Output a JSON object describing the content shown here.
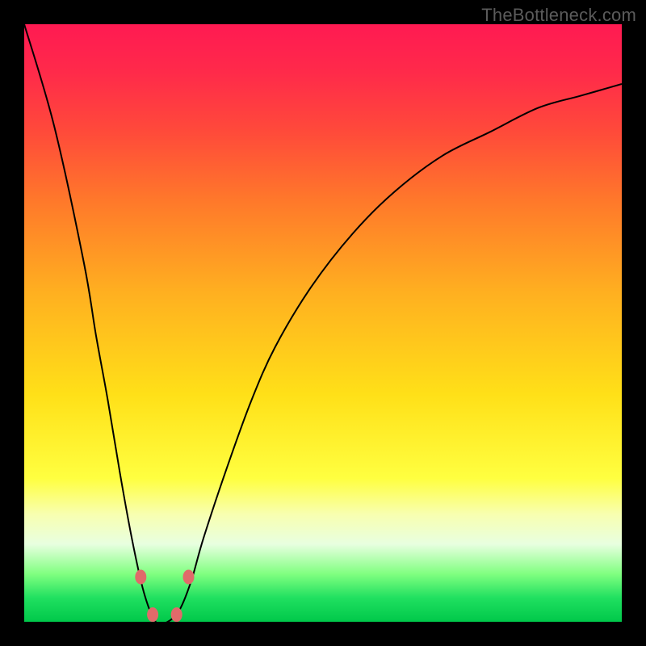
{
  "watermark": "TheBottleneck.com",
  "chart_data": {
    "type": "line",
    "title": "",
    "xlabel": "",
    "ylabel": "",
    "x": [
      0.0,
      0.05,
      0.1,
      0.12,
      0.14,
      0.16,
      0.18,
      0.2,
      0.22,
      0.24,
      0.26,
      0.28,
      0.3,
      0.34,
      0.38,
      0.42,
      0.48,
      0.55,
      0.62,
      0.7,
      0.78,
      0.86,
      0.93,
      1.0
    ],
    "values": [
      1.0,
      0.83,
      0.6,
      0.48,
      0.37,
      0.25,
      0.14,
      0.05,
      0.0,
      0.0,
      0.02,
      0.07,
      0.14,
      0.26,
      0.37,
      0.46,
      0.56,
      0.65,
      0.72,
      0.78,
      0.82,
      0.86,
      0.88,
      0.9
    ],
    "xlim": [
      0,
      1
    ],
    "ylim": [
      0,
      1
    ],
    "markers": [
      {
        "x": 0.195,
        "y": 0.075
      },
      {
        "x": 0.215,
        "y": 0.012
      },
      {
        "x": 0.255,
        "y": 0.012
      },
      {
        "x": 0.275,
        "y": 0.075
      }
    ],
    "annotations": [],
    "legend": []
  },
  "colors": {
    "gradient_top": "#ff1a52",
    "gradient_bottom": "#00c84a",
    "curve": "#000000",
    "marker": "#e06a6a",
    "frame": "#000000"
  }
}
